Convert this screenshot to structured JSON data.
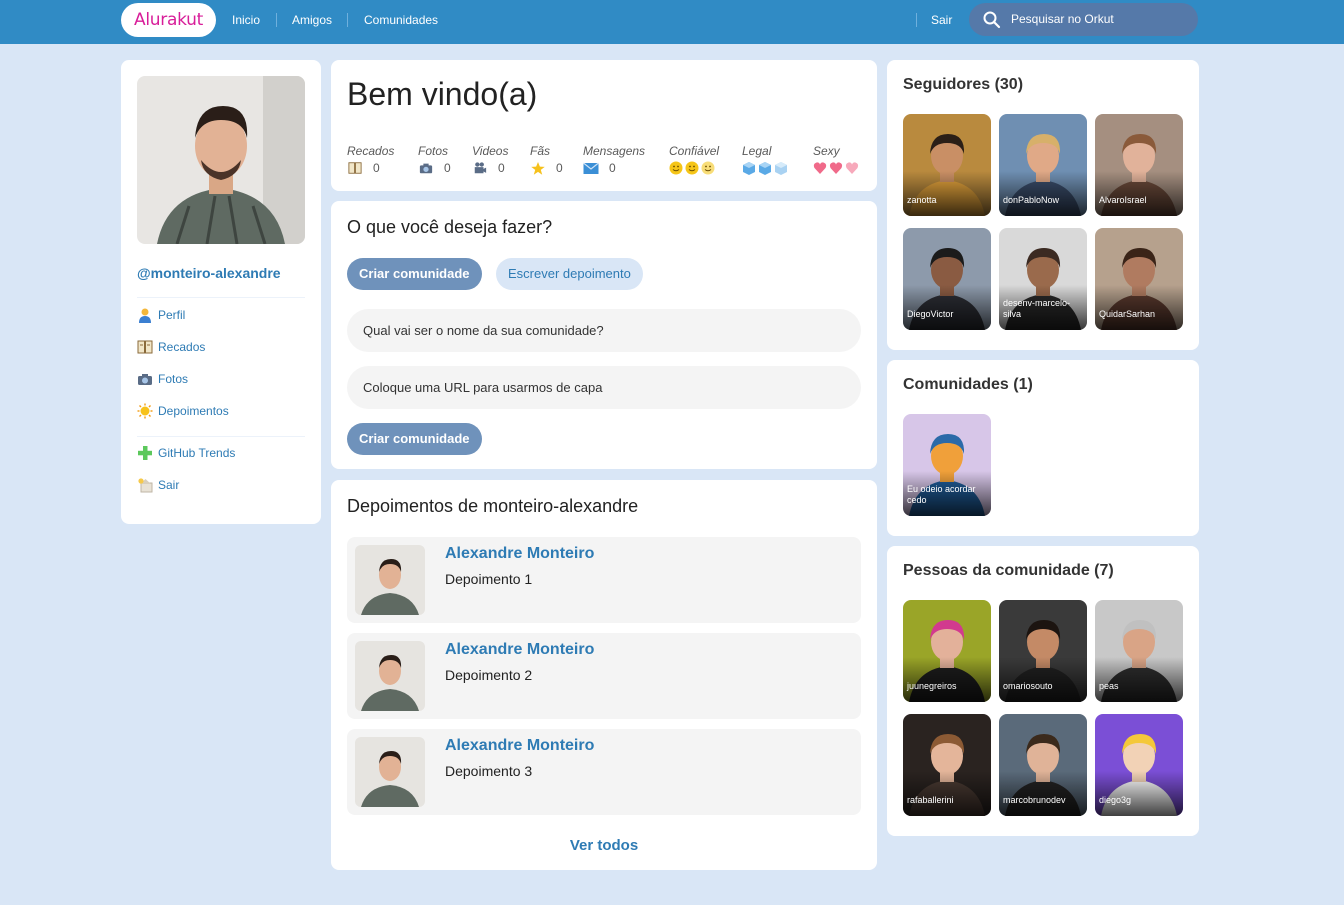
{
  "topbar": {
    "logo": "Alurakut",
    "nav": [
      "Inicio",
      "Amigos",
      "Comunidades"
    ],
    "logout": "Sair",
    "search_placeholder": "Pesquisar no Orkut"
  },
  "profile": {
    "username": "@monteiro-alexandre",
    "menu": [
      {
        "label": "Perfil",
        "icon": "user-icon"
      },
      {
        "label": "Recados",
        "icon": "book-icon"
      },
      {
        "label": "Fotos",
        "icon": "camera-icon"
      },
      {
        "label": "Depoimentos",
        "icon": "sun-icon"
      },
      {
        "label": "GitHub Trends",
        "icon": "plus-icon"
      },
      {
        "label": "Sair",
        "icon": "exit-icon"
      }
    ]
  },
  "welcome": {
    "title": "Bem vindo(a)",
    "stats": [
      {
        "label": "Recados",
        "value": "0",
        "icon": "book-icon"
      },
      {
        "label": "Fotos",
        "value": "0",
        "icon": "camera-icon"
      },
      {
        "label": "Videos",
        "value": "0",
        "icon": "video-camera-icon"
      },
      {
        "label": "Fãs",
        "value": "0",
        "icon": "star-icon"
      },
      {
        "label": "Mensagens",
        "value": "0",
        "icon": "envelope-icon"
      },
      {
        "label": "Confiável",
        "rating": 3,
        "icon": "smiley-icon"
      },
      {
        "label": "Legal",
        "rating": 3,
        "icon": "ice-cube-icon"
      },
      {
        "label": "Sexy",
        "rating": 3,
        "icon": "heart-icon"
      }
    ]
  },
  "actions": {
    "title": "O que você deseja fazer?",
    "create_community": "Criar comunidade",
    "write_testimonial": "Escrever depoimento",
    "name_placeholder": "Qual vai ser o nome da sua comunidade?",
    "url_placeholder": "Coloque uma URL para usarmos de capa",
    "submit": "Criar comunidade"
  },
  "testimonials": {
    "title": "Depoimentos de monteiro-alexandre",
    "items": [
      {
        "author": "Alexandre Monteiro",
        "text": "Depoimento 1"
      },
      {
        "author": "Alexandre Monteiro",
        "text": "Depoimento 2"
      },
      {
        "author": "Alexandre Monteiro",
        "text": "Depoimento 3"
      }
    ],
    "see_all": "Ver todos"
  },
  "followers": {
    "title": "Seguidores (30)",
    "items": [
      {
        "name": "zanotta",
        "bg": "#b98a3e",
        "skin": "#c98f65",
        "hair": "#2b1f17",
        "shirt": "#e2a23b"
      },
      {
        "name": "donPabloNow",
        "bg": "#6f8fb2",
        "skin": "#e0a987",
        "hair": "#d7b06a",
        "shirt": "#3a4d6b"
      },
      {
        "name": "AlvaroIsrael",
        "bg": "#a58f80",
        "skin": "#e1b29a",
        "hair": "#8a5a3a",
        "shirt": "#6b4a3a"
      },
      {
        "name": "DiegoVictor",
        "bg": "#8d9aab",
        "skin": "#8a5b42",
        "hair": "#1b1b1b",
        "shirt": "#2d2f36"
      },
      {
        "name": "desenv-marcelo-silva",
        "bg": "#d9d9d9",
        "skin": "#9a6a4c",
        "hair": "#3b2a22",
        "shirt": "#2a2a2a"
      },
      {
        "name": "QuidarSarhan",
        "bg": "#b6a18d",
        "skin": "#b07b60",
        "hair": "#3a2418",
        "shirt": "#5b3a2e"
      }
    ]
  },
  "communities": {
    "title": "Comunidades (1)",
    "items": [
      {
        "name": "Eu odeio acordar cedo",
        "bg": "#d7c6e8",
        "skin": "#f0a03a",
        "hair": "#2b6aa8",
        "shirt": "#1f5e9c"
      }
    ]
  },
  "community_people": {
    "title": "Pessoas da comunidade (7)",
    "items": [
      {
        "name": "juunegreiros",
        "bg": "#9aa528",
        "skin": "#e3b19a",
        "hair": "#d23a8e",
        "shirt": "#1e1e1e"
      },
      {
        "name": "omariosouto",
        "bg": "#3a3a3a",
        "skin": "#c48a66",
        "hair": "#1c1410",
        "shirt": "#222222"
      },
      {
        "name": "peas",
        "bg": "#c8c8c8",
        "skin": "#d9a486",
        "hair": "#c0c0c0",
        "shirt": "#2f2f2f"
      },
      {
        "name": "rafaballerini",
        "bg": "#2a2320",
        "skin": "#e4b59a",
        "hair": "#8c5a34",
        "shirt": "#4b3b33"
      },
      {
        "name": "marcobrunodev",
        "bg": "#5a6a7a",
        "skin": "#e0b398",
        "hair": "#3b2a1c",
        "shirt": "#242424"
      },
      {
        "name": "diego3g",
        "bg": "#7b4fd6",
        "skin": "#f2d2b6",
        "hair": "#f4c83a",
        "shirt": "#ffffff"
      }
    ]
  }
}
